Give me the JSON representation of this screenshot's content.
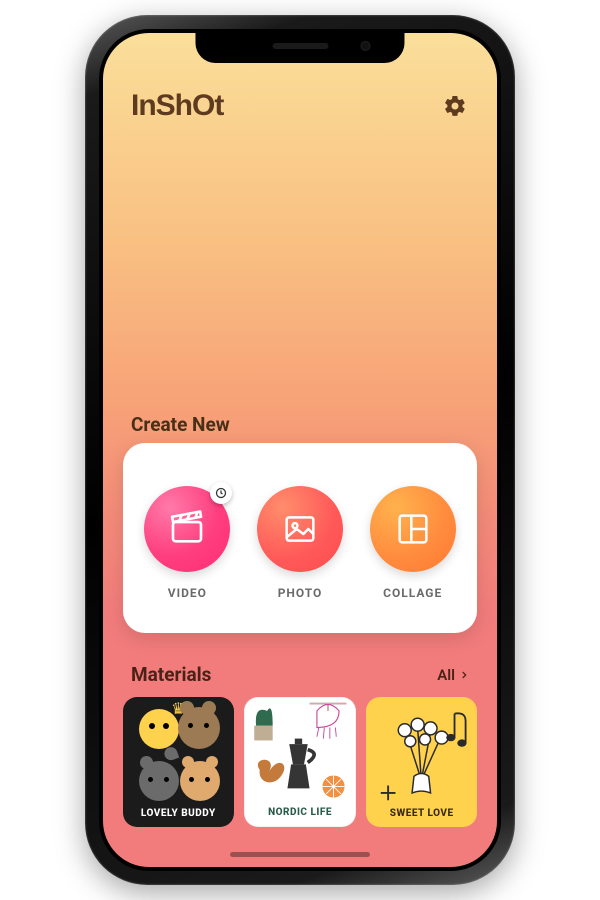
{
  "header": {
    "app_name": "InShOt",
    "settings_icon": "gear-icon"
  },
  "create": {
    "section_title": "Create New",
    "items": [
      {
        "label": "VIDEO",
        "icon": "clapper-icon",
        "color": "grad-pink",
        "badge": "clock-icon"
      },
      {
        "label": "PHOTO",
        "icon": "image-icon",
        "color": "grad-red"
      },
      {
        "label": "COLLAGE",
        "icon": "grid-icon",
        "color": "grad-orange"
      }
    ]
  },
  "materials": {
    "section_title": "Materials",
    "all_label": "All",
    "packs": [
      {
        "label": "LOVELY BUDDY"
      },
      {
        "label": "NORDIC LIFE"
      },
      {
        "label": "SWEET LOVE"
      }
    ]
  }
}
